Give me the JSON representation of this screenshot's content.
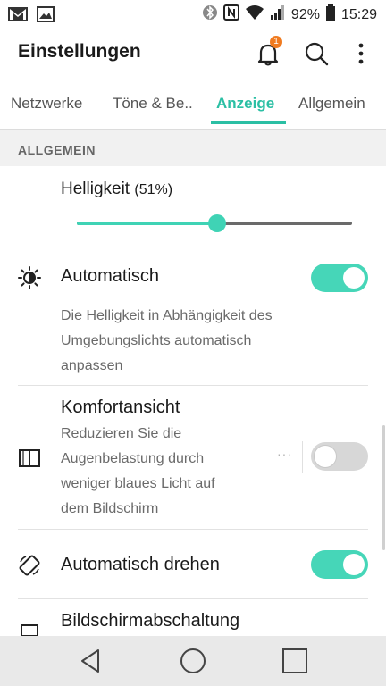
{
  "status_bar": {
    "left_icons": [
      "gmail-icon",
      "gallery-icon"
    ],
    "right_icons": [
      "bluetooth-icon",
      "nfc-icon",
      "wifi-icon",
      "signal-icon",
      "battery-icon"
    ],
    "battery": "92%",
    "time": "15:29"
  },
  "header": {
    "title": "Einstellungen",
    "notification_count": "1"
  },
  "tabs": [
    {
      "label": "Netzwerke",
      "active": false
    },
    {
      "label": "Töne & Be..",
      "active": false
    },
    {
      "label": "Anzeige",
      "active": true
    },
    {
      "label": "Allgemein",
      "active": false
    }
  ],
  "section": {
    "title": "ALLGEMEIN"
  },
  "brightness": {
    "label": "Helligkeit",
    "percent_text": "(51%)",
    "value": 0.51
  },
  "settings": {
    "auto_brightness": {
      "title": "Automatisch",
      "desc_lines": [
        "Die Helligkeit in Abhängigkeit des",
        "Umgebungslichts automatisch",
        "anpassen"
      ],
      "enabled": true
    },
    "comfort_view": {
      "title": "Komfortansicht",
      "desc_lines": [
        "Reduzieren Sie die",
        "Augenbelastung durch",
        "weniger blaues Licht auf",
        "dem Bildschirm"
      ],
      "enabled": false,
      "more": "···"
    },
    "auto_rotate": {
      "title": "Automatisch drehen",
      "enabled": true
    },
    "screen_timeout": {
      "title": "Bildschirmabschaltung"
    }
  },
  "colors": {
    "accent": "#2bbfa4",
    "toggle_on": "#46d6b8",
    "toggle_off": "#d7d7d7",
    "badge": "#f07b20"
  }
}
